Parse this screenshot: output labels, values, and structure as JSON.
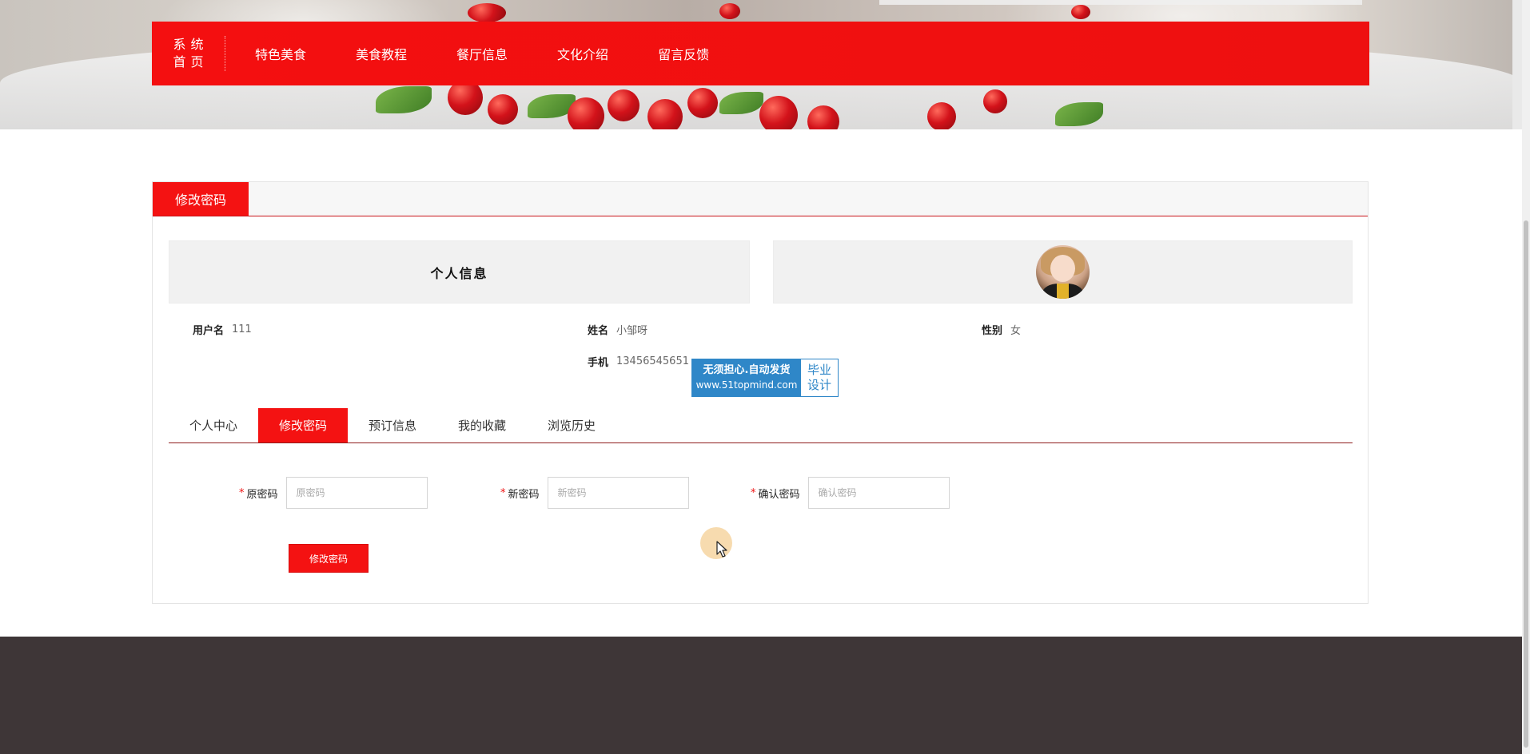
{
  "nav": {
    "brand_line1": "系统",
    "brand_line2": "首页",
    "items": [
      {
        "label": "特色美食"
      },
      {
        "label": "美食教程"
      },
      {
        "label": "餐厅信息"
      },
      {
        "label": "文化介绍"
      },
      {
        "label": "留言反馈"
      }
    ]
  },
  "panel": {
    "title": "修改密码",
    "info_heading": "个人信息",
    "fields": {
      "username": {
        "label": "用户名",
        "value": "111"
      },
      "name": {
        "label": "姓名",
        "value": "小邹呀"
      },
      "gender": {
        "label": "性别",
        "value": "女"
      },
      "phone": {
        "label": "手机",
        "value": "13456545651"
      }
    },
    "tabs": [
      {
        "label": "个人中心",
        "active": false
      },
      {
        "label": "修改密码",
        "active": true
      },
      {
        "label": "预订信息",
        "active": false
      },
      {
        "label": "我的收藏",
        "active": false
      },
      {
        "label": "浏览历史",
        "active": false
      }
    ],
    "form": {
      "required_mark": "*",
      "old_password": {
        "label": "原密码",
        "placeholder": "原密码",
        "value": ""
      },
      "new_password": {
        "label": "新密码",
        "placeholder": "新密码",
        "value": ""
      },
      "confirm_password": {
        "label": "确认密码",
        "placeholder": "确认密码",
        "value": ""
      },
      "submit_label": "修改密码"
    }
  },
  "watermark": {
    "line1": "无须担心.自动发货",
    "url": "www.51topmind.com",
    "right_line1": "毕业",
    "right_line2": "设计"
  },
  "colors": {
    "accent": "#f41212",
    "footer": "#3e3637",
    "watermark": "#2f87c8"
  }
}
